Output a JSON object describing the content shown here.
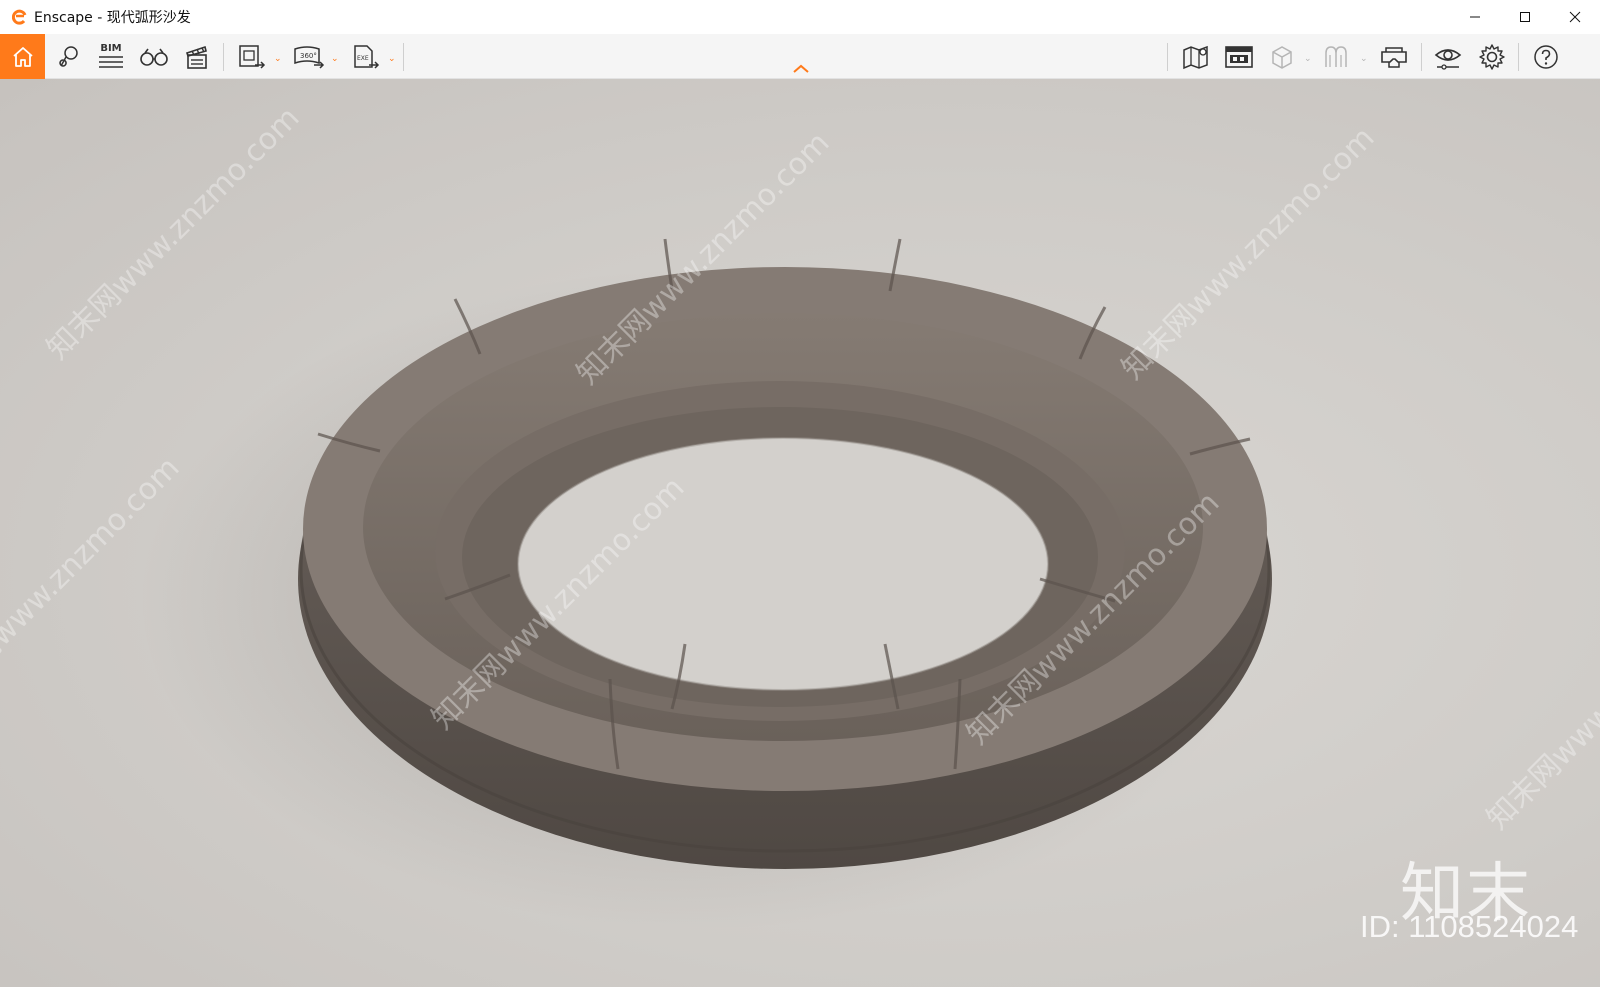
{
  "window": {
    "title": "Enscape - 现代弧形沙发",
    "accent": "#ff7a1a"
  },
  "toolbar": {
    "left_icons": [
      "home-icon",
      "map-pin-icon",
      "bim-icon",
      "binoculars-icon",
      "clapperboard-icon",
      "screenshot-export-icon",
      "panorama-360-export-icon",
      "exe-export-icon"
    ],
    "bim_label": "BIM",
    "panorama_label": "360°",
    "exe_label": "EXE",
    "right_icons": [
      "map-icon",
      "asset-library-icon",
      "cube-icon",
      "material-icon",
      "vr-headset-icon",
      "visual-settings-icon",
      "settings-gear-icon",
      "help-icon"
    ]
  },
  "watermark": {
    "diagonal_text": "知末网www.znzmo.com",
    "logo": "知末",
    "id_text": "ID: 1108524024"
  }
}
